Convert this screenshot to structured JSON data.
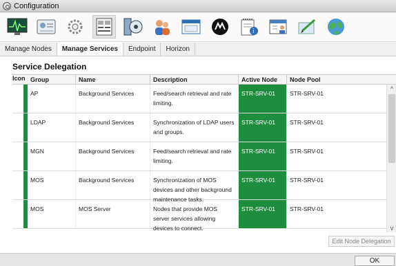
{
  "window": {
    "title": "Configuration"
  },
  "toolbar": {
    "icons": [
      "network-monitor-icon",
      "device-card-icon",
      "gear-icon",
      "server-panel-icon",
      "disk-archive-icon",
      "users-icon",
      "window-icon",
      "brand-logo-icon",
      "notepad-icon",
      "calendar-user-icon",
      "pen-edit-icon",
      "globe-icon"
    ]
  },
  "tabs": [
    {
      "label": "Manage Nodes",
      "active": false
    },
    {
      "label": "Manage Services",
      "active": true
    },
    {
      "label": "Endpoint",
      "active": false
    },
    {
      "label": "Horizon",
      "active": false
    }
  ],
  "section": {
    "title": "Service Delegation"
  },
  "table": {
    "columns": {
      "icon": "Icon",
      "group": "Group",
      "name": "Name",
      "description": "Description",
      "active_node": "Active Node",
      "node_pool": "Node Pool"
    },
    "rows": [
      {
        "group": "AP",
        "name": "Background Services",
        "description": "Feed/search retrieval and rate limiting.",
        "active_node": "STR-SRV-01",
        "node_pool": "STR-SRV-01"
      },
      {
        "group": "LDAP",
        "name": "Background Services",
        "description": "Synchronization of LDAP users and groups.",
        "active_node": "STR-SRV-01",
        "node_pool": "STR-SRV-01"
      },
      {
        "group": "MGN",
        "name": "Background Services",
        "description": "Feed/search retrieval and rate limiting.",
        "active_node": "STR-SRV-01",
        "node_pool": "STR-SRV-01"
      },
      {
        "group": "MOS",
        "name": "Background Services",
        "description": "Synchronization of MOS devices and other background maintenance tasks.",
        "active_node": "STR-SRV-01",
        "node_pool": "STR-SRV-01"
      },
      {
        "group": "MOS",
        "name": "MOS Server",
        "description": "Nodes that provide MOS server services allowing devices to connect.",
        "active_node": "STR-SRV-01",
        "node_pool": "STR-SRV-01"
      }
    ],
    "status_color": "#1e8e3e"
  },
  "buttons": {
    "edit": "Edit Node Delegation",
    "ok": "OK"
  },
  "scroll": {
    "up": "^",
    "down": "v"
  }
}
